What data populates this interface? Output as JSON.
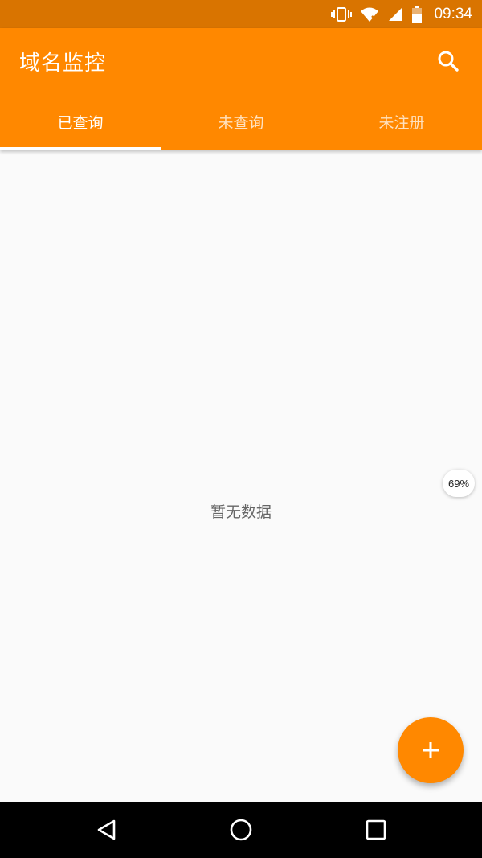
{
  "status_bar": {
    "time": "09:34",
    "icons": [
      "vibrate-icon",
      "wifi-icon",
      "signal-icon",
      "battery-icon"
    ]
  },
  "app_bar": {
    "title": "域名监控",
    "search_icon": "search-icon",
    "color": "#ff8800"
  },
  "tabs": [
    {
      "label": "已查询",
      "active": true
    },
    {
      "label": "未查询",
      "active": false
    },
    {
      "label": "未注册",
      "active": false
    }
  ],
  "content": {
    "empty_message": "暂无数据"
  },
  "badge": {
    "text": "69%"
  },
  "fab": {
    "icon": "plus-icon"
  },
  "nav_bar": {
    "buttons": [
      "back-icon",
      "home-icon",
      "recents-icon"
    ]
  }
}
